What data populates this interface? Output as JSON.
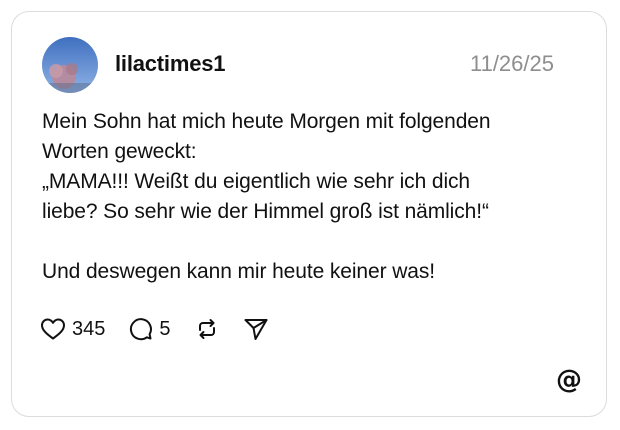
{
  "post": {
    "username": "lilactimes1",
    "date": "11/26/25",
    "text": "Mein Sohn hat mich heute Morgen mit folgenden\nWorten geweckt:\n„MAMA!!! Weißt du eigentlich wie sehr ich dich\nliebe? So sehr wie der Himmel groß ist nämlich!“\n\nUnd deswegen kann mir heute keiner was!"
  },
  "actions": {
    "likes": "345",
    "replies": "5"
  },
  "icons": {
    "like": "heart-icon",
    "reply": "speech-bubble-icon",
    "repost": "repost-icon",
    "share": "paper-plane-icon",
    "logo": "threads-logo-icon"
  },
  "colors": {
    "text": "#111111",
    "muted": "#8e8e8e",
    "border": "#dcdcdc"
  }
}
